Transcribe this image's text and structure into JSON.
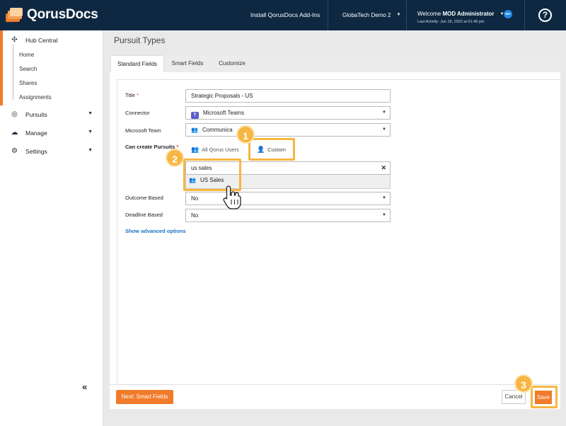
{
  "header": {
    "logo_text": "QorusDocs",
    "install_link": "Install QorusDocs Add-Ins",
    "tenant": "GlobaTech Demo 2",
    "welcome_prefix": "Welcome",
    "user_name": "MOD Administrator",
    "last_activity": "Last Activity: Jun 19, 2022 at 01:45 pm",
    "avatar_initials": "MA",
    "help_symbol": "?",
    "colors": {
      "bar": "#0e2841",
      "accent": "#f07b2a"
    }
  },
  "sidebar": {
    "hub_label": "Hub Central",
    "hub_sub": [
      "Home",
      "Search",
      "Shares",
      "Assignments"
    ],
    "items": [
      {
        "label": "Pursuits",
        "icon": "target-icon"
      },
      {
        "label": "Manage",
        "icon": "cloud-server-icon"
      },
      {
        "label": "Settings",
        "icon": "gear-icon"
      }
    ],
    "collapse_symbol": "«"
  },
  "page": {
    "title": "Pursuit Types",
    "tabs": [
      "Standard Fields",
      "Smart Fields",
      "Customize"
    ],
    "active_tab": "Standard Fields"
  },
  "form": {
    "title_label": "Title",
    "required_mark": "*",
    "title_value": "Strategic Proposals - US",
    "connector_label": "Connector",
    "connector_value": "Microsoft Teams",
    "team_label": "Microsoft Team",
    "team_value": "Communica",
    "can_create_label": "Can create Pursuits",
    "option_all": "All Qorus Users",
    "option_custom": "Custom",
    "search_value": "us sales",
    "search_result": "US Sales",
    "outcome_label": "Outcome Based",
    "outcome_value": "No",
    "deadline_label": "Deadline Based",
    "deadline_value": "No",
    "advanced_link": "Show advanced options"
  },
  "footer": {
    "next_label": "Next: Smart Fields",
    "cancel_label": "Cancel",
    "save_label": "Save"
  },
  "callouts": [
    "1",
    "2",
    "3"
  ]
}
